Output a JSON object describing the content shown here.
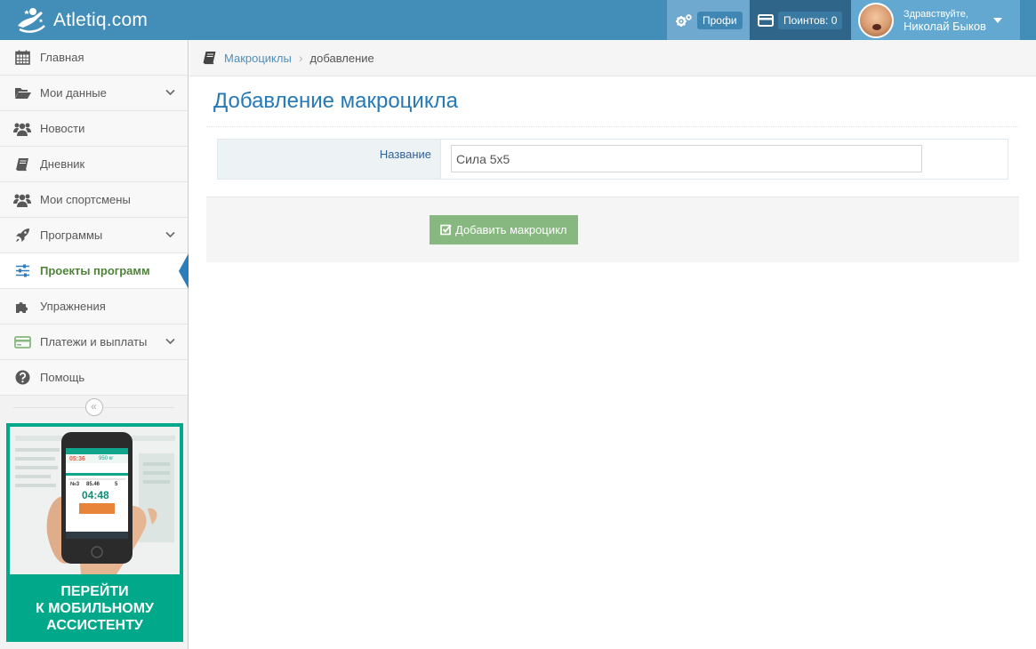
{
  "header": {
    "brand": "Atletiq.com",
    "pro_label": "Профи",
    "points_label": "Поинтов: 0",
    "greeting": "Здравствуйте,",
    "user_name": "Николай Быков"
  },
  "sidebar": {
    "items": [
      {
        "label": "Главная",
        "icon": "calendar-icon"
      },
      {
        "label": "Мои данные",
        "icon": "folder-open-icon",
        "has_submenu": true
      },
      {
        "label": "Новости",
        "icon": "users-icon"
      },
      {
        "label": "Дневник",
        "icon": "book-icon"
      },
      {
        "label": "Мои спортсмены",
        "icon": "users-icon"
      },
      {
        "label": "Программы",
        "icon": "rocket-icon",
        "has_submenu": true
      },
      {
        "label": "Проекты программ",
        "icon": "sliders-icon",
        "active": true
      },
      {
        "label": "Упражнения",
        "icon": "puzzle-icon"
      },
      {
        "label": "Платежи и выплаты",
        "icon": "credit-card-icon",
        "has_submenu": true
      },
      {
        "label": "Помощь",
        "icon": "question-circle-icon"
      }
    ],
    "collapse_icon": "double-chevron-left-icon",
    "promo": {
      "screen_timer": "04:48",
      "screen_top_left": "05:36",
      "screen_top_right": "950 кг",
      "screen_set": "№3",
      "screen_weight": "85.46",
      "screen_reps": "5",
      "line1": "ПЕРЕЙТИ",
      "line2": "К МОБИЛЬНОМУ",
      "line3": "АССИСТЕНТУ"
    }
  },
  "breadcrumbs": {
    "icon": "book-icon",
    "link": "Макроциклы",
    "current": "добавление"
  },
  "page": {
    "title": "Добавление макроцикла",
    "name_label": "Название",
    "name_value": "Сила 5х5",
    "submit_label": "Добавить макроцикл"
  },
  "colors": {
    "navbar": "#438eb9",
    "accent": "#2679b5",
    "active_text": "#4f8339",
    "button": "#87b87f",
    "promo": "#01a98a"
  }
}
